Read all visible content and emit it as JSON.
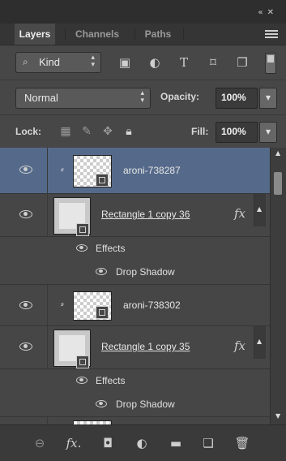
{
  "panel": {
    "collapse_glyph": "«  ✕",
    "tabs": [
      {
        "label": "Layers",
        "active": true
      },
      {
        "label": "Channels",
        "active": false
      },
      {
        "label": "Paths",
        "active": false
      }
    ]
  },
  "filter": {
    "kind_label": "Kind",
    "kind_icon": "search-icon",
    "filter_icons": [
      "pixel-layer-filter-icon",
      "adjustment-layer-filter-icon",
      "type-layer-filter-icon",
      "shape-layer-filter-icon",
      "smart-object-filter-icon"
    ]
  },
  "blend": {
    "mode": "Normal",
    "opacity_label": "Opacity:",
    "opacity_value": "100%"
  },
  "lock": {
    "label": "Lock:",
    "fill_label": "Fill:",
    "fill_value": "100%"
  },
  "layers": [
    {
      "name": "aroni-738287",
      "type": "smart-object",
      "selected": true,
      "linked": true
    },
    {
      "name": "Rectangle 1 copy 36",
      "type": "shape",
      "selected": false,
      "has_fx": true,
      "effects_label": "Effects",
      "effect": "Drop Shadow"
    },
    {
      "name": "aroni-738302",
      "type": "smart-object",
      "selected": false,
      "linked": true
    },
    {
      "name": "Rectangle 1 copy 35",
      "type": "shape",
      "selected": false,
      "has_fx": true,
      "effects_label": "Effects",
      "effect": "Drop Shadow"
    }
  ],
  "bottom_bar_icons": [
    "link-layers-icon",
    "fx-icon",
    "layer-mask-icon",
    "adjustment-layer-icon",
    "new-group-icon",
    "new-layer-icon",
    "delete-icon"
  ],
  "colors": {
    "panel_bg": "#474747",
    "selected_row": "#556a8a",
    "text": "#e6e6e6"
  }
}
